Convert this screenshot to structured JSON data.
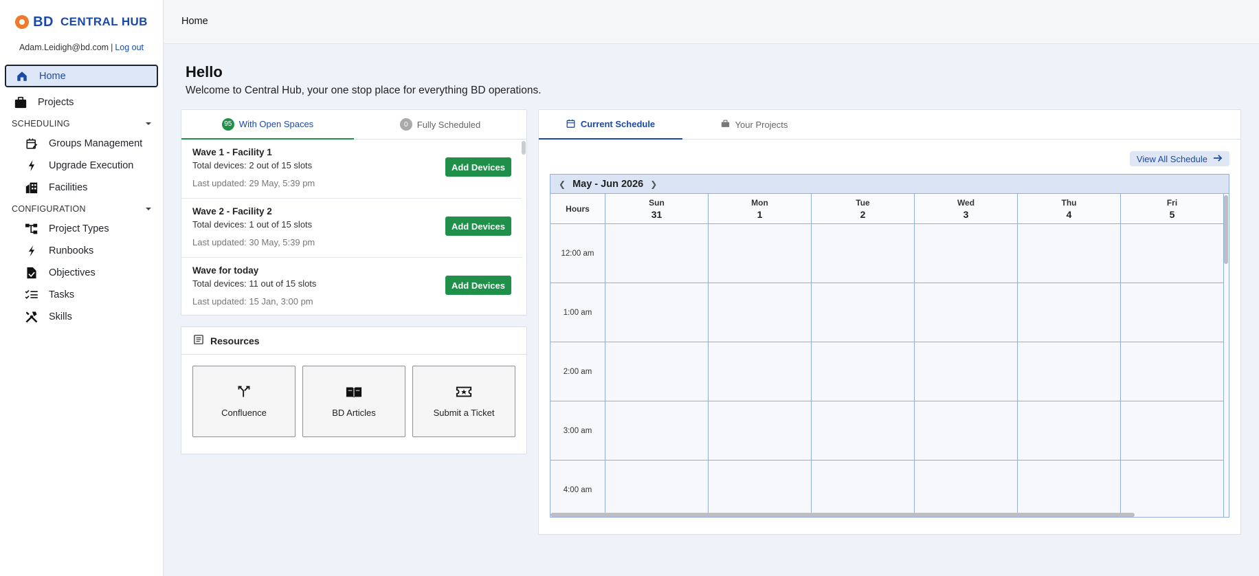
{
  "brand": {
    "bd": "BD",
    "hub": "CENTRAL HUB",
    "accent": "#1a4aa8",
    "logo_color": "#f07a2a"
  },
  "user": {
    "email": "Adam.Leidigh@bd.com",
    "separator": "|",
    "logout": "Log out"
  },
  "sidebar": {
    "home": "Home",
    "projects": "Projects",
    "scheduling_label": "SCHEDULING",
    "scheduling_items": [
      {
        "label": "Groups Management",
        "icon": "calendar-edit-icon"
      },
      {
        "label": "Upgrade Execution",
        "icon": "lightning-icon"
      },
      {
        "label": "Facilities",
        "icon": "building-icon"
      }
    ],
    "configuration_label": "CONFIGURATION",
    "configuration_items": [
      {
        "label": "Project Types",
        "icon": "hierarchy-icon"
      },
      {
        "label": "Runbooks",
        "icon": "bolt-icon"
      },
      {
        "label": "Objectives",
        "icon": "file-check-icon"
      },
      {
        "label": "Tasks",
        "icon": "checklist-icon"
      },
      {
        "label": "Skills",
        "icon": "tools-icon"
      }
    ]
  },
  "topbar": {
    "breadcrumb": "Home"
  },
  "page": {
    "greeting": "Hello",
    "welcome": "Welcome to Central Hub, your one stop place for everything BD operations."
  },
  "waves": {
    "tab_open": {
      "count": "95",
      "label": "With Open Spaces"
    },
    "tab_full": {
      "count": "0",
      "label": "Fully Scheduled"
    },
    "add_label": "Add Devices",
    "items": [
      {
        "title": "Wave 1 - Facility 1",
        "total": "Total devices: 2 out of 15 slots",
        "updated": "Last updated: 29 May, 5:39 pm"
      },
      {
        "title": "Wave 2 - Facility 2",
        "total": "Total devices: 1 out of 15 slots",
        "updated": "Last updated: 30 May, 5:39 pm"
      },
      {
        "title": "Wave for today",
        "total": "Total devices: 11 out of 15 slots",
        "updated": "Last updated: 15 Jan, 3:00 pm"
      }
    ]
  },
  "resources": {
    "title": "Resources",
    "tiles": [
      {
        "label": "Confluence",
        "icon": "merge-icon"
      },
      {
        "label": "BD Articles",
        "icon": "book-icon"
      },
      {
        "label": "Submit a Ticket",
        "icon": "ticket-icon"
      }
    ]
  },
  "schedule": {
    "tab_current": "Current Schedule",
    "tab_projects": "Your Projects",
    "view_all": "View All Schedule",
    "month": "May - Jun 2026",
    "hours_label": "Hours",
    "days": [
      {
        "dow": "Sun",
        "num": "31"
      },
      {
        "dow": "Mon",
        "num": "1"
      },
      {
        "dow": "Tue",
        "num": "2"
      },
      {
        "dow": "Wed",
        "num": "3"
      },
      {
        "dow": "Thu",
        "num": "4"
      },
      {
        "dow": "Fri",
        "num": "5"
      }
    ],
    "hours": [
      "12:00 am",
      "1:00 am",
      "2:00 am",
      "3:00 am",
      "4:00 am"
    ]
  }
}
